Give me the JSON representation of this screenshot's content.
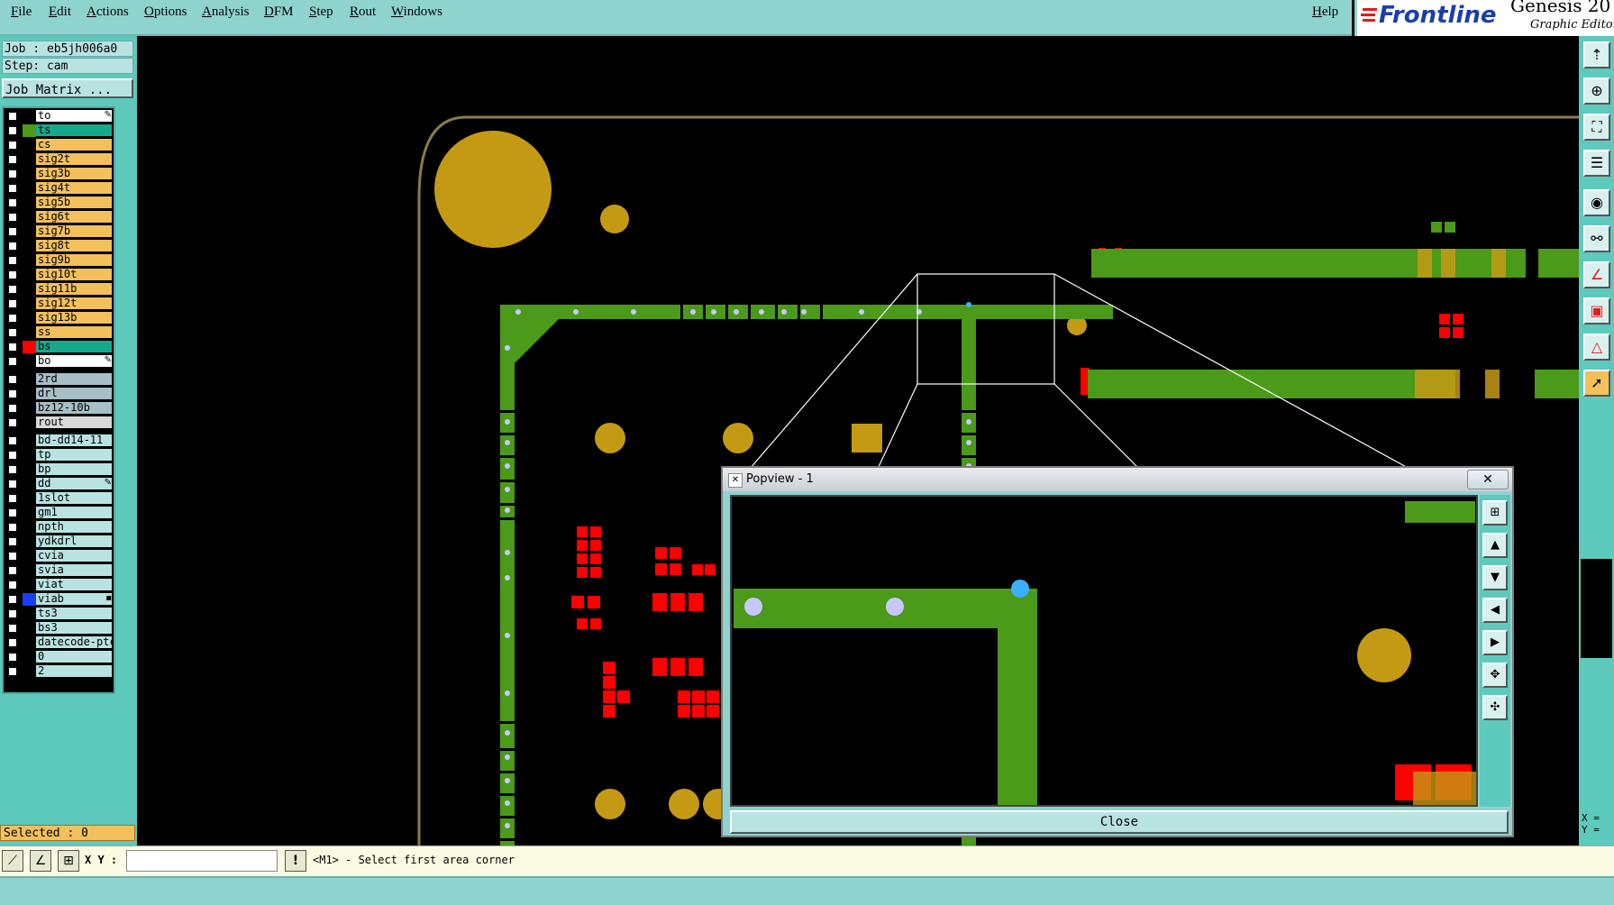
{
  "menu": {
    "items": [
      "File",
      "Edit",
      "Actions",
      "Options",
      "Analysis",
      "DFM",
      "Step",
      "Rout",
      "Windows"
    ],
    "help": "Help"
  },
  "brand": {
    "logo": "Frontline",
    "product": "Genesis 20",
    "subtitle": "Graphic Editor"
  },
  "job": {
    "job_label": "Job : eb5jh006a0",
    "step_label": "Step: cam",
    "matrix_button": "Job Matrix ..."
  },
  "layers": [
    {
      "name": "to",
      "bg": "#ffffff",
      "marker": "#000000",
      "mark": "✎"
    },
    {
      "name": "ts",
      "bg": "#17a88c",
      "marker": "#4b9a1a",
      "mark": ""
    },
    {
      "name": "cs",
      "bg": "#f3c05c",
      "marker": "#000000",
      "mark": ""
    },
    {
      "name": "sig2t",
      "bg": "#f3c05c",
      "marker": "#000000",
      "mark": ""
    },
    {
      "name": "sig3b",
      "bg": "#f3c05c",
      "marker": "#000000",
      "mark": ""
    },
    {
      "name": "sig4t",
      "bg": "#f3c05c",
      "marker": "#000000",
      "mark": ""
    },
    {
      "name": "sig5b",
      "bg": "#f3c05c",
      "marker": "#000000",
      "mark": ""
    },
    {
      "name": "sig6t",
      "bg": "#f3c05c",
      "marker": "#000000",
      "mark": ""
    },
    {
      "name": "sig7b",
      "bg": "#f3c05c",
      "marker": "#000000",
      "mark": ""
    },
    {
      "name": "sig8t",
      "bg": "#f3c05c",
      "marker": "#000000",
      "mark": ""
    },
    {
      "name": "sig9b",
      "bg": "#f3c05c",
      "marker": "#000000",
      "mark": ""
    },
    {
      "name": "sig10t",
      "bg": "#f3c05c",
      "marker": "#000000",
      "mark": ""
    },
    {
      "name": "sig11b",
      "bg": "#f3c05c",
      "marker": "#000000",
      "mark": ""
    },
    {
      "name": "sig12t",
      "bg": "#f3c05c",
      "marker": "#000000",
      "mark": ""
    },
    {
      "name": "sig13b",
      "bg": "#f3c05c",
      "marker": "#000000",
      "mark": ""
    },
    {
      "name": "ss",
      "bg": "#f3c05c",
      "marker": "#000000",
      "mark": ""
    },
    {
      "name": "bs",
      "bg": "#17a88c",
      "marker": "#ff0000",
      "mark": ""
    },
    {
      "name": "bo",
      "bg": "#ffffff",
      "marker": "#000000",
      "mark": "✎"
    },
    {
      "name": "2rd",
      "bg": "#a8bfc6",
      "marker": "#000000",
      "mark": ""
    },
    {
      "name": "drl",
      "bg": "#a8bfc6",
      "marker": "#000000",
      "mark": ""
    },
    {
      "name": "bz12-10b",
      "bg": "#a8bfc6",
      "marker": "#000000",
      "mark": ""
    },
    {
      "name": "rout",
      "bg": "#d9d9d9",
      "marker": "#000000",
      "mark": ""
    },
    {
      "name": "bd-dd14-11",
      "bg": "#b9e3e0",
      "marker": "#000000",
      "mark": ""
    },
    {
      "name": "tp",
      "bg": "#b9e3e0",
      "marker": "#000000",
      "mark": ""
    },
    {
      "name": "bp",
      "bg": "#b9e3e0",
      "marker": "#000000",
      "mark": ""
    },
    {
      "name": "dd",
      "bg": "#b9e3e0",
      "marker": "#000000",
      "mark": "✎"
    },
    {
      "name": "1slot",
      "bg": "#b9e3e0",
      "marker": "#000000",
      "mark": ""
    },
    {
      "name": "gm1",
      "bg": "#b9e3e0",
      "marker": "#000000",
      "mark": ""
    },
    {
      "name": "npth",
      "bg": "#b9e3e0",
      "marker": "#000000",
      "mark": ""
    },
    {
      "name": "ydkdrl",
      "bg": "#b9e3e0",
      "marker": "#000000",
      "mark": ""
    },
    {
      "name": "cvia",
      "bg": "#b9e3e0",
      "marker": "#000000",
      "mark": ""
    },
    {
      "name": "svia",
      "bg": "#b9e3e0",
      "marker": "#000000",
      "mark": ""
    },
    {
      "name": "viat",
      "bg": "#b9e3e0",
      "marker": "#000000",
      "mark": ""
    },
    {
      "name": "viab",
      "bg": "#b9e3e0",
      "marker": "#1a3cff",
      "mark": "▪"
    },
    {
      "name": "ts3",
      "bg": "#b9e3e0",
      "marker": "#000000",
      "mark": ""
    },
    {
      "name": "bs3",
      "bg": "#b9e3e0",
      "marker": "#000000",
      "mark": ""
    },
    {
      "name": "datecode-ptc",
      "bg": "#b9e3e0",
      "marker": "#000000",
      "mark": ""
    },
    {
      "name": "0",
      "bg": "#b9e3e0",
      "marker": "#000000",
      "mark": ""
    },
    {
      "name": "2",
      "bg": "#b9e3e0",
      "marker": "#000000",
      "mark": ""
    }
  ],
  "selected": "Selected : 0",
  "status": {
    "xy_label": "X Y :",
    "xy_value": "",
    "message": "<M1> - Select first area corner"
  },
  "coords": {
    "x": "X =",
    "y": "Y ="
  },
  "popview": {
    "title": "Popview - 1",
    "close_label": "Close"
  },
  "colors": {
    "panel": "#5ec9bd",
    "menubar": "#8fd3cf",
    "copper": "#c49a14",
    "trace": "#4b9a1a",
    "pad_red": "#ff0000"
  }
}
